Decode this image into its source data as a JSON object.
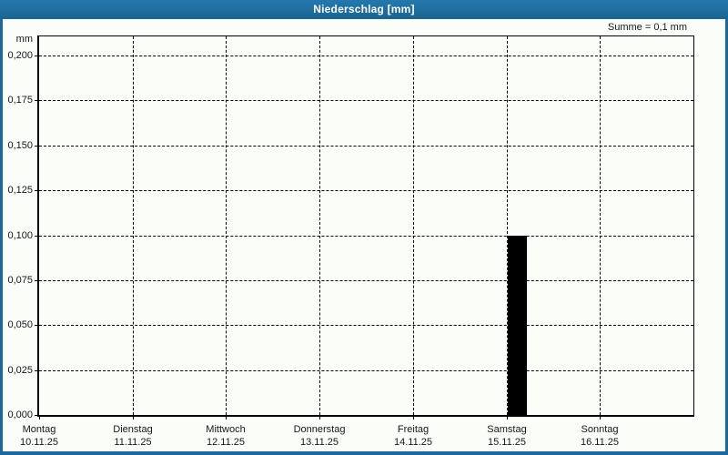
{
  "window": {
    "title": "Niederschlag [mm]",
    "summary": "Summe = 0,1 mm",
    "colors": {
      "titlebar": "#1d689e",
      "frame_border": "#1d689e",
      "panel_background": "#fbfdf8",
      "bar_fill": "#000000",
      "grid_line": "#000000",
      "label_text": "#16161e",
      "title_text": "#ffffff"
    }
  },
  "chart_data": {
    "type": "bar",
    "title": "Niederschlag [mm]",
    "annotation": "Summe = 0,1 mm",
    "ylabel": "mm",
    "ylim": [
      0,
      0.2
    ],
    "ytick_step": 0.025,
    "yticks": [
      {
        "value": 0.2,
        "label": "0,200"
      },
      {
        "value": 0.175,
        "label": "0,175"
      },
      {
        "value": 0.15,
        "label": "0,150"
      },
      {
        "value": 0.125,
        "label": "0,125"
      },
      {
        "value": 0.1,
        "label": "0,100"
      },
      {
        "value": 0.075,
        "label": "0,075"
      },
      {
        "value": 0.05,
        "label": "0,050"
      },
      {
        "value": 0.025,
        "label": "0,025"
      },
      {
        "value": 0.0,
        "label": "0,000"
      }
    ],
    "categories": [
      {
        "day": "Montag",
        "date": "10.11.25"
      },
      {
        "day": "Dienstag",
        "date": "11.11.25"
      },
      {
        "day": "Mittwoch",
        "date": "12.11.25"
      },
      {
        "day": "Donnerstag",
        "date": "13.11.25"
      },
      {
        "day": "Freitag",
        "date": "14.11.25"
      },
      {
        "day": "Samstag",
        "date": "15.11.25"
      },
      {
        "day": "Sonntag",
        "date": "16.11.25"
      }
    ],
    "values": [
      0,
      0,
      0,
      0,
      0,
      0.1,
      0
    ],
    "grid": "both-dashed",
    "legend": "none",
    "decimal_separator": ","
  }
}
